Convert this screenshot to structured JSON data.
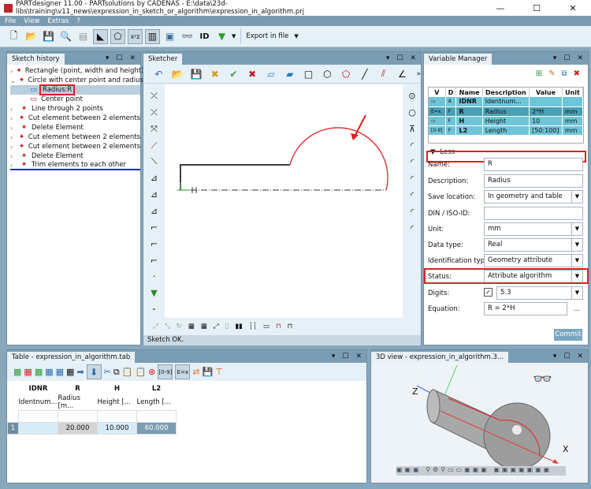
{
  "window": {
    "title": "PARTdesigner 11.00 - PARTsolutions by CADENAS - E:\\data\\23d-libs\\training\\v11_news\\expression_in_sketch_or_algorithm\\expression_in_algorithm.prj",
    "minimize": "—",
    "maximize": "☐",
    "close": "✕"
  },
  "menu": [
    "File",
    "View",
    "Extras",
    "?"
  ],
  "toolbar": {
    "export_label": "Export in file"
  },
  "sketch_history": {
    "title": "Sketch history",
    "items": [
      {
        "label": "Rectangle (point, width and height)",
        "icon": "rectangle-icon",
        "expand": ">"
      },
      {
        "label": "Circle with center point and radius",
        "icon": "circle-icon",
        "expand": "v"
      },
      {
        "label": "Radius:R",
        "icon": "variable-icon",
        "child": true,
        "selected": true
      },
      {
        "label": "Center point",
        "icon": "point-icon",
        "child": true
      },
      {
        "label": "Line through 2 points",
        "icon": "line-icon",
        "expand": ">"
      },
      {
        "label": "Cut element between 2 elements",
        "icon": "cut-icon",
        "expand": ">"
      },
      {
        "label": "Delete Element",
        "icon": "eraser-icon",
        "expand": ">"
      },
      {
        "label": "Cut element between 2 elements",
        "icon": "cut-icon",
        "expand": ">"
      },
      {
        "label": "Cut element between 2 elements",
        "icon": "cut-icon",
        "expand": ">"
      },
      {
        "label": "Delete Element",
        "icon": "eraser-icon",
        "expand": ">"
      },
      {
        "label": "Trim elements to each other",
        "icon": "trim-icon",
        "expand": ">"
      }
    ]
  },
  "sketcher": {
    "title": "Sketcher",
    "status": "Sketch OK.",
    "more": "»"
  },
  "variable_manager": {
    "title": "Variable Manager",
    "columns": [
      "V",
      "D",
      "Name",
      "Description",
      "Value",
      "Unit"
    ],
    "rows": [
      {
        "v": "▭",
        "d": "A",
        "name": "IDNR",
        "description": "Identnum...",
        "value": "",
        "unit": ""
      },
      {
        "v": "E=x",
        "d": "F",
        "name": "R",
        "description": "Radius",
        "value": "2*H",
        "unit": "mm"
      },
      {
        "v": "▭",
        "d": "F",
        "name": "H",
        "description": "Height",
        "value": "10",
        "unit": "mm"
      },
      {
        "v": "[0-9]",
        "d": "F",
        "name": "L2",
        "description": "Length",
        "value": "[50:100]",
        "unit": "mm"
      }
    ],
    "toggle": "Less",
    "fields": {
      "name_label": "Name:",
      "name": "R",
      "description_label": "Description:",
      "description": "Radius",
      "save_location_label": "Save location:",
      "save_location": "In geometry and table",
      "din_label": "DIN / ISO-ID:",
      "din": "",
      "unit_label": "Unit:",
      "unit": "mm",
      "data_type_label": "Data type:",
      "data_type": "Real",
      "ident_type_label": "Identification type:",
      "ident_type": "Geometry attribute",
      "status_label": "Status:",
      "status": "Attribute algorithm",
      "digits_label": "Digits:",
      "digits": "5.3",
      "digits_checked": true,
      "equation_label": "Equation:",
      "equation": "R = 2*H",
      "more": "..."
    },
    "commit": "Commit"
  },
  "table": {
    "title": "Table - expression_in_algorithm.tab",
    "columns": [
      {
        "name": "IDNR",
        "desc": "Identnum..."
      },
      {
        "name": "R",
        "desc": "Radius [m..."
      },
      {
        "name": "H",
        "desc": "Height [..."
      },
      {
        "name": "L2",
        "desc": "Length [..."
      }
    ],
    "rows": [
      {
        "index": "1",
        "cells": [
          "",
          "20.000",
          "10.000",
          "60.000"
        ]
      }
    ]
  },
  "view3d": {
    "title": "3D view - expression_in_algorithm.3...",
    "axis_z": "Z",
    "axis_x": "X"
  },
  "colors": {
    "accent_red": "#e02020",
    "header": "#7b9db3",
    "selection": "#6fc5d8"
  }
}
